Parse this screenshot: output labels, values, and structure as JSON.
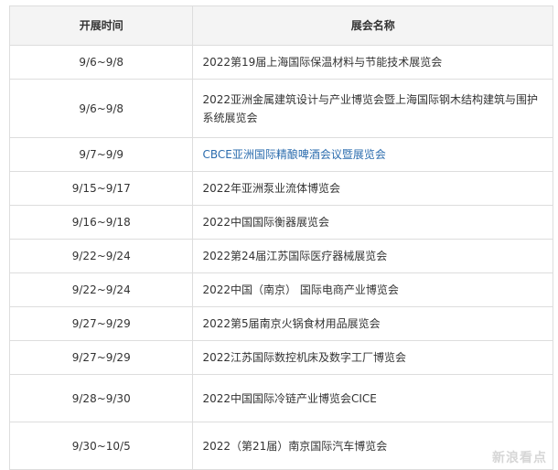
{
  "table": {
    "headers": {
      "date": "开展时间",
      "name": "展会名称"
    },
    "rows": [
      {
        "date": "9/6~9/8",
        "name": "2022第19届上海国际保温材料与节能技术展览会",
        "link": false
      },
      {
        "date": "9/6~9/8",
        "name": "2022亚洲金属建筑设计与产业博览会暨上海国际钢木结构建筑与围护系统展览会",
        "link": false
      },
      {
        "date": "9/7~9/9",
        "name": "CBCE亚洲国际精酿啤酒会议暨展览会",
        "link": true
      },
      {
        "date": "9/15~9/17",
        "name": "2022年亚洲泵业流体博览会",
        "link": false
      },
      {
        "date": "9/16~9/18",
        "name": "2022中国国际衡器展览会",
        "link": false
      },
      {
        "date": "9/22~9/24",
        "name": "2022第24届江苏国际医疗器械展览会",
        "link": false
      },
      {
        "date": "9/22~9/24",
        "name": "2022中国（南京） 国际电商产业博览会",
        "link": false
      },
      {
        "date": "9/27~9/29",
        "name": "2022第5届南京火锅食材用品展览会",
        "link": false
      },
      {
        "date": "9/27~9/29",
        "name": "2022江苏国际数控机床及数字工厂博览会",
        "link": false
      },
      {
        "date": "9/28~9/30",
        "name": "2022中国国际冷链产业博览会CICE",
        "link": false
      },
      {
        "date": "9/30~10/5",
        "name": "2022（第21届）南京国际汽车博览会",
        "link": false
      }
    ]
  },
  "watermark": "新浪看点",
  "colors": {
    "link": "#2b6cae",
    "header_bg": "#f4f4f4",
    "border": "#dddddd",
    "text": "#333333"
  }
}
